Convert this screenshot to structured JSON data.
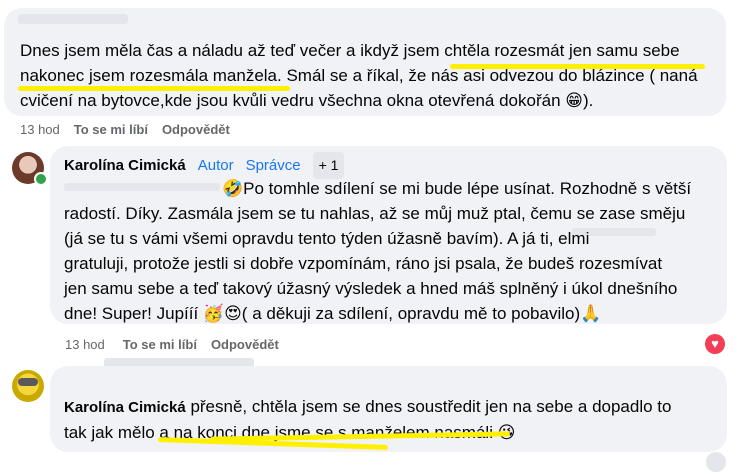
{
  "comment1": {
    "text": "Dnes jsem měla čas a náladu až teď večer a ikdyž jsem chtěla rozesmát jen samu sebe\nnakonec jsem rozesmála manžela. Smál se a říkal, že nás asi odvezou do blázince ( naná\ncvičení na bytovce,kde jsou kvůli vedru všechna okna otevřená dokořán 😁).",
    "time": "13 hod",
    "like": "To se mi líbí",
    "reply": "Odpovědět"
  },
  "comment2": {
    "author": "Karolína Cimická",
    "badge_author": "Autor",
    "badge_admin": "Správce",
    "badge_extra": "+ 1",
    "text": "🤣Po tomhle sdílení se mi bude lépe usínat. Rozhodně s větší\nradostí. Díky. Zasmála jsem se tu nahlas, až se můj muž ptal, čemu se zase směju\n(já se tu s vámi všemi opravdu tento týden úžasně bavím). A já ti,                elmi\ngratuluji, protože jestli si dobře vzpomínám, ráno jsi psala, že budeš rozesmívat\njen samu sebe a teď takový úžasný výsledek a hned máš splněný i úkol dnešního\ndne! Super! Jupííí 🥳😍( a děkuji za sdílení, opravdu mě to pobavilo)🙏",
    "time": "13 hod",
    "like": "To se mi líbí",
    "reply": "Odpovědět"
  },
  "comment3": {
    "author": "Karolína Cimická",
    "text_first": " přesně, chtěla jsem se dnes soustředit jen na sebe a dopadlo to",
    "text_second": "tak jak mělo a na konci dne jsme se s manželem nasmáli 😘"
  },
  "colors": {
    "highlight": "#fff000",
    "bubble": "#f0f2f5",
    "badge": "#1877f2",
    "heart": "#f33e58"
  }
}
